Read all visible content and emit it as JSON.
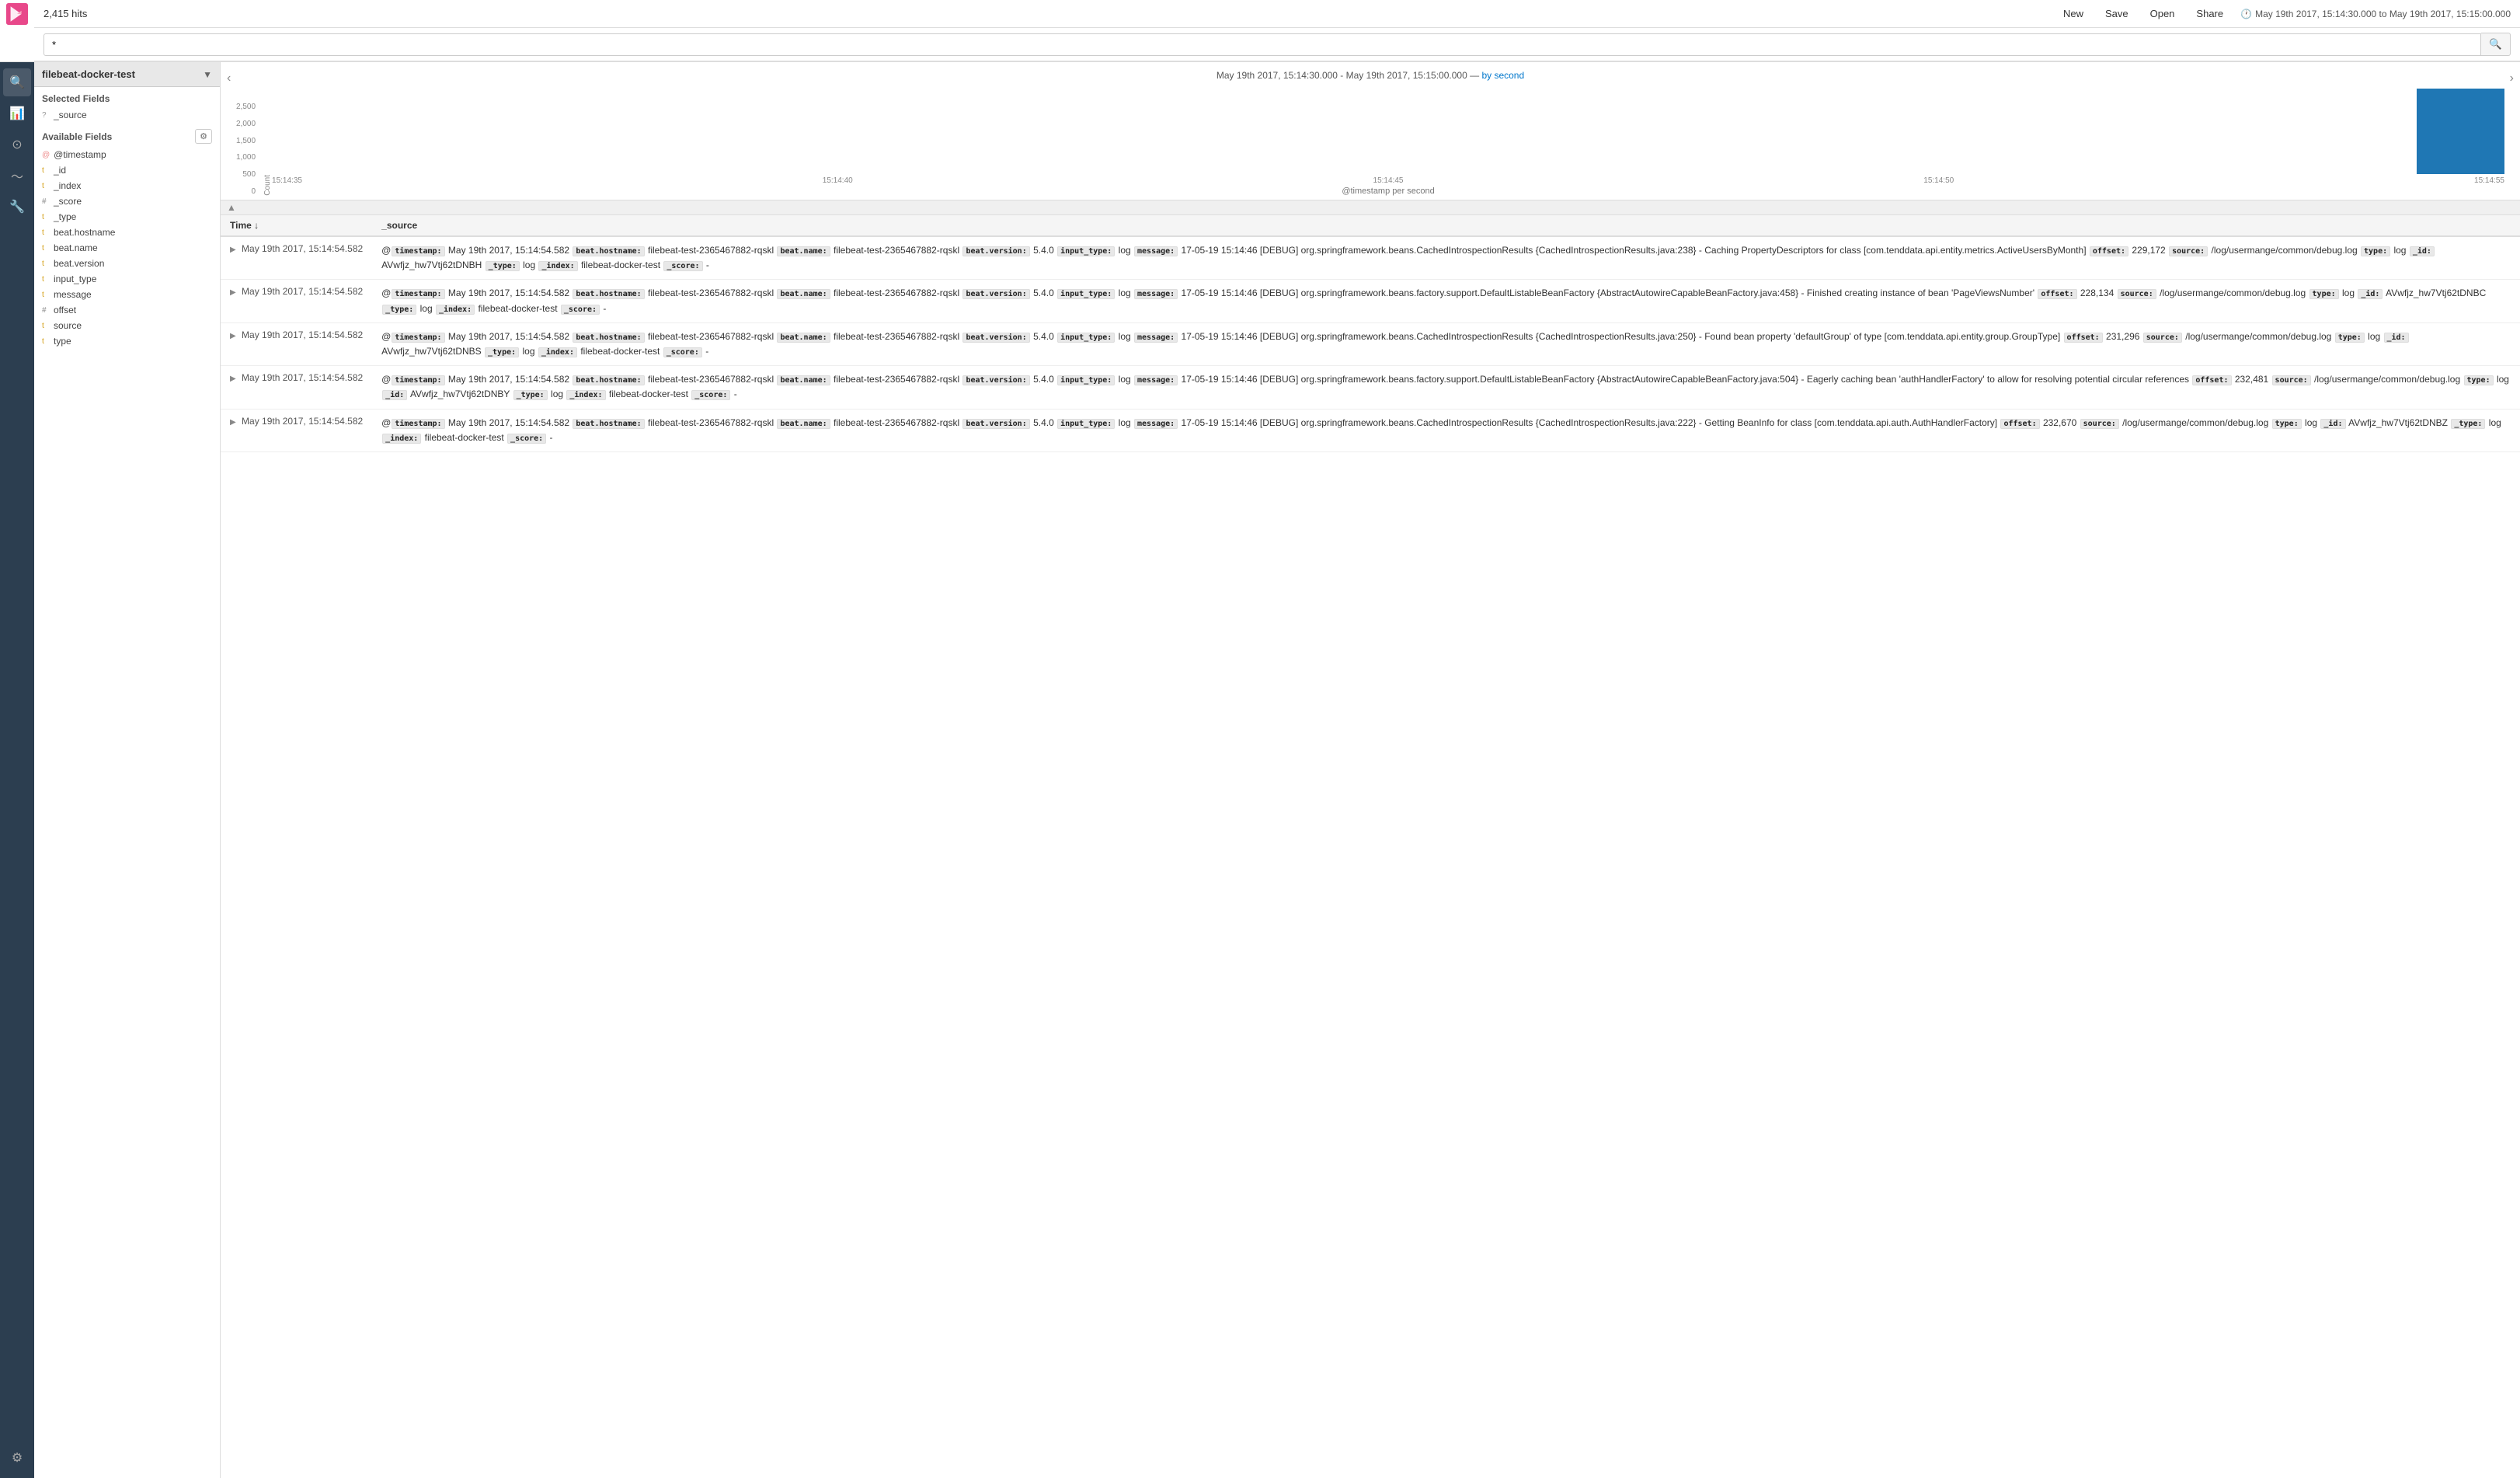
{
  "header": {
    "hits": "2,415 hits",
    "buttons": {
      "new": "New",
      "save": "Save",
      "open": "Open",
      "share": "Share"
    },
    "time_range": "May 19th 2017, 15:14:30.000 to May 19th 2017, 15:15:00.000",
    "search_value": "*",
    "search_placeholder": ""
  },
  "sidebar": {
    "index_name": "filebeat-docker-test",
    "selected_fields_label": "Selected Fields",
    "selected_fields": [
      {
        "name": "_source",
        "type": "?"
      }
    ],
    "available_fields_label": "Available Fields",
    "available_fields": [
      {
        "name": "@timestamp",
        "type": "@"
      },
      {
        "name": "_id",
        "type": "t"
      },
      {
        "name": "_index",
        "type": "t"
      },
      {
        "name": "_score",
        "type": "#"
      },
      {
        "name": "_type",
        "type": "t"
      },
      {
        "name": "beat.hostname",
        "type": "t"
      },
      {
        "name": "beat.name",
        "type": "t"
      },
      {
        "name": "beat.version",
        "type": "t"
      },
      {
        "name": "input_type",
        "type": "t"
      },
      {
        "name": "message",
        "type": "t"
      },
      {
        "name": "offset",
        "type": "#"
      },
      {
        "name": "source",
        "type": "t"
      },
      {
        "name": "type",
        "type": "t"
      }
    ]
  },
  "chart": {
    "title": "May 19th 2017, 15:14:30.000 - May 19th 2017, 15:15:00.000",
    "by_second_label": "by second",
    "x_labels": [
      "15:14:35",
      "15:14:40",
      "15:14:45",
      "15:14:50",
      "15:14:55"
    ],
    "y_labels": [
      "2,500",
      "2,000",
      "1,500",
      "1,000",
      "500",
      "0"
    ],
    "x_axis_label": "@timestamp per second",
    "y_axis_label": "Count",
    "bars": [
      0,
      0,
      0,
      0,
      0,
      0,
      0,
      0,
      0,
      0,
      0,
      0,
      0,
      0,
      0,
      0,
      0,
      0,
      0,
      0,
      0,
      0,
      0,
      0,
      100
    ]
  },
  "results": {
    "col_time": "Time",
    "col_source": "_source",
    "rows": [
      {
        "time": "May 19th 2017, 15:14:54.582",
        "source": "@timestamp: May 19th 2017, 15:14:54.582  beat.hostname: filebeat-test-2365467882-rqskl  beat.name: filebeat-test-2365467882-rqskl  beat.version: 5.4.0  input_type: log  message: 17-05-19 15:14:46 [DEBUG] org.springframework.beans.CachedIntrospectionResults {CachedIntrospectionResults.java:238} - Caching PropertyDescriptors for class [com.tenddata.api.entity.metrics.ActiveUsersByMonth]  offset: 229,172  source: /log/usermange/common/debug.log  type: log  _id: AVwfjz_hw7Vtj62tDNBH  _type: log  _index: filebeat-docker-test  _score: -"
      },
      {
        "time": "May 19th 2017, 15:14:54.582",
        "source": "@timestamp: May 19th 2017, 15:14:54.582  beat.hostname: filebeat-test-2365467882-rqskl  beat.name: filebeat-test-2365467882-rqskl  beat.version: 5.4.0  input_type: log  message: 17-05-19 15:14:46 [DEBUG] org.springframework.beans.factory.support.DefaultListableBeanFactory {AbstractAutowireCapableBeanFactory.java:458} - Finished creating instance of bean 'PageViewsNumber'  offset: 228,134  source: /log/usermange/common/debug.log  type: log  _id: AVwfjz_hw7Vtj62tDNBC  _type: log  _index: filebeat-docker-test  _score: -"
      },
      {
        "time": "May 19th 2017, 15:14:54.582",
        "source": "@timestamp: May 19th 2017, 15:14:54.582  beat.hostname: filebeat-test-2365467882-rqskl  beat.name: filebeat-test-2365467882-rqskl  beat.version: 5.4.0  input_type: log  message: 17-05-19 15:14:46 [DEBUG] org.springframework.beans.CachedIntrospectionResults {CachedIntrospectionResults.java:250} - Found bean property 'defaultGroup' of type [com.tenddata.api.entity.group.GroupType]  offset: 231,296  source: /log/usermange/common/debug.log  type: log  _id: AVwfjz_hw7Vtj62tDNBS  _type: log  _index: filebeat-docker-test  _score: -"
      },
      {
        "time": "May 19th 2017, 15:14:54.582",
        "source": "@timestamp: May 19th 2017, 15:14:54.582  beat.hostname: filebeat-test-2365467882-rqskl  beat.name: filebeat-test-2365467882-rqskl  beat.version: 5.4.0  input_type: log  message: 17-05-19 15:14:46 [DEBUG] org.springframework.beans.factory.support.DefaultListableBeanFactory {AbstractAutowireCapableBeanFactory.java:504} - Eagerly caching bean 'authHandlerFactory' to allow for resolving potential circular references  offset: 232,481  source: /log/usermange/common/debug.log  type: log  _id: AVwfjz_hw7Vtj62tDNBY  _type: log  _index: filebeat-docker-test  _score: -"
      },
      {
        "time": "May 19th 2017, 15:14:54.582",
        "source": "@timestamp: May 19th 2017, 15:14:54.582  beat.hostname: filebeat-test-2365467882-rqskl  beat.name: filebeat-test-2365467882-rqskl  beat.version: 5.4.0  input_type: log  message: 17-05-19 15:14:46 [DEBUG] org.springframework.beans.CachedIntrospectionResults {CachedIntrospectionResults.java:222} - Getting BeanInfo for class [com.tenddata.api.auth.AuthHandlerFactory]  offset: 232,670  source: /log/usermange/common/debug.log  type: log  _id: AVwfjz_hw7Vtj62tDNBZ  _type: log  _index: filebeat-docker-test  _score: -"
      }
    ]
  },
  "nav_icons": {
    "discover": "🔍",
    "visualize": "📊",
    "dashboard": "⊙",
    "timelion": "〜",
    "devtools": "🔧",
    "management": "⚙"
  }
}
